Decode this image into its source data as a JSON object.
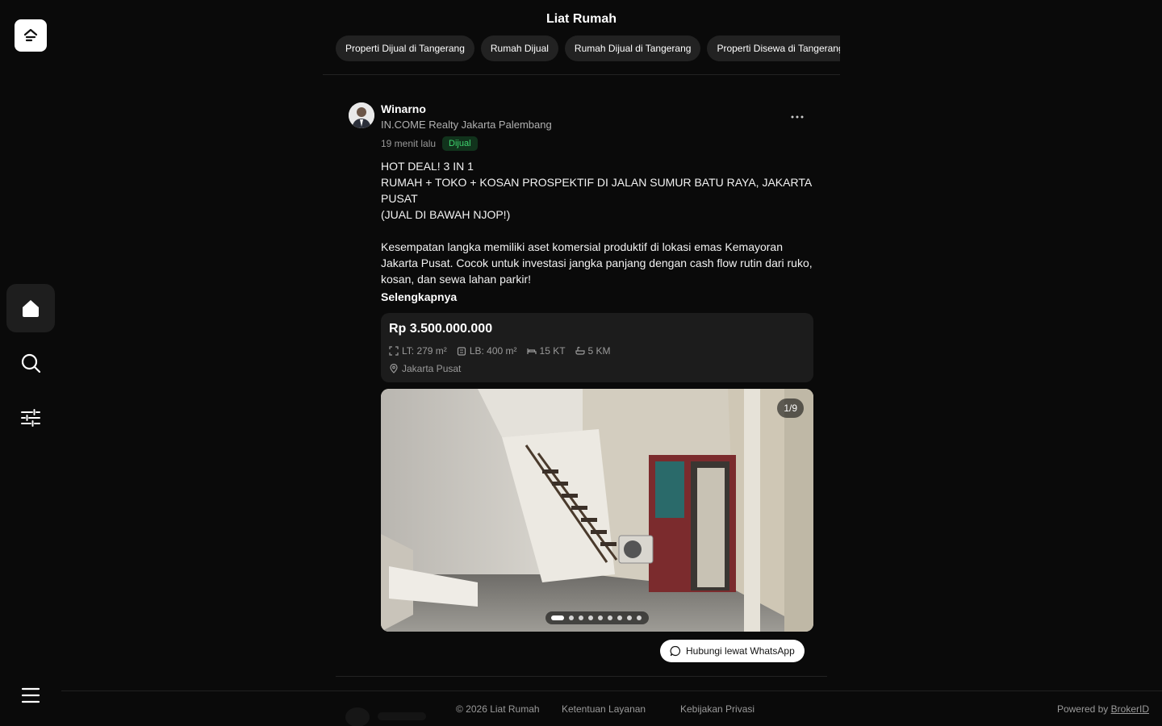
{
  "site": {
    "title": "Liat Rumah"
  },
  "chips": [
    "Properti Dijual di Tangerang",
    "Rumah Dijual",
    "Rumah Dijual di Tangerang",
    "Properti Disewa di Tangerang"
  ],
  "post": {
    "author": "Winarno",
    "agency": "IN.COME Realty Jakarta Palembang",
    "time": "19 menit lalu",
    "badge": "Dijual",
    "description": "HOT DEAL! 3 IN 1\nRUMAH + TOKO + KOSAN PROSPEKTIF DI JALAN SUMUR BATU RAYA, JAKARTA PUSAT\n(JUAL DI BAWAH NJOP!)\n\nKesempatan langka memiliki aset komersial produktif di lokasi emas Kemayoran Jakarta Pusat. Cocok untuk investasi jangka panjang dengan cash flow rutin dari ruko, kosan, dan sewa lahan parkir!",
    "read_more": "Selengkapnya",
    "price": "Rp 3.500.000.000",
    "specs": {
      "land": "LT: 279 m²",
      "building": "LB: 400 m²",
      "bedrooms": "15 KT",
      "bathrooms": "5 KM"
    },
    "location": "Jakarta Pusat",
    "photo_counter": "1/9",
    "photo_total": 9,
    "photo_current": 1,
    "whatsapp_label": "Hubungi lewat WhatsApp"
  },
  "footer": {
    "copyright": "© 2026 Liat Rumah",
    "terms": "Ketentuan Layanan",
    "privacy": "Kebijakan Privasi",
    "powered_prefix": "Powered by",
    "powered_link": "BrokerID"
  },
  "icons": {
    "logo": "liat-rumah-logo-icon",
    "home": "home-icon",
    "search": "search-icon",
    "filter": "sliders-icon",
    "menu": "hamburger-menu-icon"
  },
  "colors": {
    "background": "#0a0a0a",
    "badge_text": "#3fd56f",
    "badge_bg": "#11331c",
    "card": "#1c1c1c"
  }
}
